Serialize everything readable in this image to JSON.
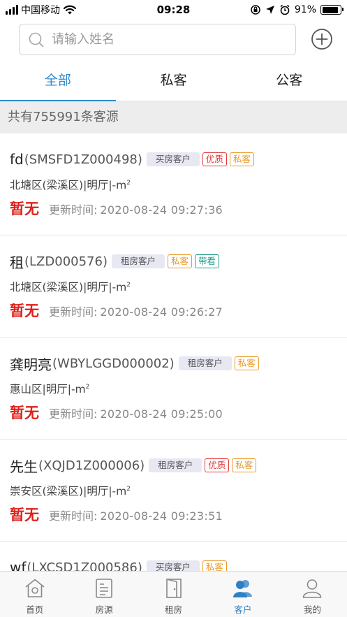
{
  "status_bar": {
    "carrier": "中国移动",
    "time": "09:28",
    "battery": "91%",
    "battery_level": 0.91
  },
  "search": {
    "placeholder": "请输入姓名",
    "icon": "search-icon",
    "add_icon": "plus-circle-icon"
  },
  "tabs": [
    {
      "label": "全部",
      "active": true
    },
    {
      "label": "私客",
      "active": false
    },
    {
      "label": "公客",
      "active": false
    }
  ],
  "count_text": "共有755991条客源",
  "customers": [
    {
      "name": "fd",
      "code": "(SMSFD1Z000498)",
      "type": "买房客户",
      "tags": [
        {
          "label": "优质",
          "kind": "good"
        },
        {
          "label": "私客",
          "kind": "priv"
        }
      ],
      "location": "北塘区(梁溪区)|明厅|-m",
      "area_unit": "2",
      "price": "暂无",
      "update_label": "更新时间:",
      "update_time": "2020-08-24 09:27:36"
    },
    {
      "name": "租",
      "code": "(LZD000576)",
      "type": "租房客户",
      "tags": [
        {
          "label": "私客",
          "kind": "priv"
        },
        {
          "label": "带看",
          "kind": "view"
        }
      ],
      "location": "北塘区(梁溪区)|明厅|-m",
      "area_unit": "2",
      "price": "暂无",
      "update_label": "更新时间:",
      "update_time": "2020-08-24 09:26:27"
    },
    {
      "name": "龚明亮",
      "code": "(WBYLGGD000002)",
      "type": "租房客户",
      "tags": [
        {
          "label": "私客",
          "kind": "priv"
        }
      ],
      "location": "惠山区|明厅|-m",
      "area_unit": "2",
      "price": "暂无",
      "update_label": "更新时间:",
      "update_time": "2020-08-24 09:25:00"
    },
    {
      "name": "先生",
      "code": "(XQJD1Z000006)",
      "type": "租房客户",
      "tags": [
        {
          "label": "优质",
          "kind": "good"
        },
        {
          "label": "私客",
          "kind": "priv"
        }
      ],
      "location": "崇安区(梁溪区)|明厅|-m",
      "area_unit": "2",
      "price": "暂无",
      "update_label": "更新时间:",
      "update_time": "2020-08-24 09:23:51"
    },
    {
      "name": "wf",
      "code": "(LXCSD1Z000586)",
      "type": "买房客户",
      "tags": [
        {
          "label": "私客",
          "kind": "priv"
        }
      ],
      "location": "",
      "area_unit": "",
      "price": "",
      "update_label": "",
      "update_time": ""
    }
  ],
  "nav": [
    {
      "label": "首页",
      "icon": "home-icon",
      "active": false
    },
    {
      "label": "房源",
      "icon": "house-list-icon",
      "active": false
    },
    {
      "label": "租房",
      "icon": "door-icon",
      "active": false
    },
    {
      "label": "客户",
      "icon": "customers-icon",
      "active": true
    },
    {
      "label": "我的",
      "icon": "profile-icon",
      "active": false
    }
  ],
  "colors": {
    "accent": "#2e8bd0",
    "price": "#e0211b",
    "tag_good": "#e03a3a",
    "tag_private": "#e89a2a",
    "tag_view": "#1f9a8c"
  }
}
